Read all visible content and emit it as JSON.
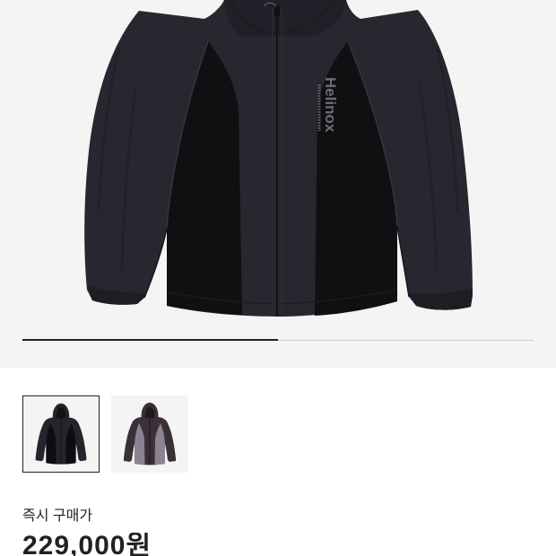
{
  "gallery": {
    "product_image": {
      "icon": "jacket-photo",
      "logo_text": "Helinox",
      "colors": {
        "shell": "#26272f",
        "hood": "#202128",
        "side_panels": "#101013",
        "cuffs": "#1d1e24",
        "logo": "#6c6d74"
      }
    },
    "progress": 0.5,
    "progress_color": "#222222",
    "track_color": "#cfcfcf",
    "background": "#f4f4f4"
  },
  "thumbnails": [
    {
      "icon": "black-jacket-thumbnail",
      "selected": true,
      "shell_color": "#24252c",
      "panel_color": "#0e0e10",
      "hood_inner_color": "#111114"
    },
    {
      "icon": "purple-jacket-thumbnail",
      "selected": false,
      "shell_color": "#3b3037",
      "panel_color": "#8b8392",
      "hood_inner_color": "#1f191d"
    }
  ],
  "price": {
    "label": "즉시 구매가",
    "value": "229,000원"
  },
  "colors": {
    "page_background": "#ffffff",
    "text": "#222222",
    "selected_border": "#222222"
  }
}
